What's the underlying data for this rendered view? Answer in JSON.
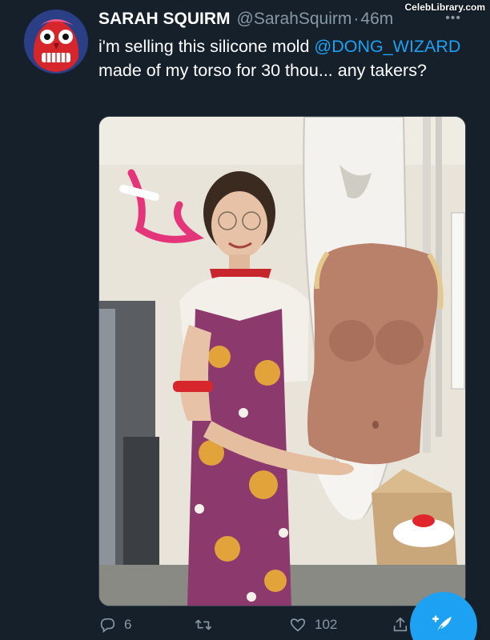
{
  "watermark": "CelebLibrary.com",
  "tweet": {
    "display_name": "SARAH SQUIRM",
    "handle": "@SarahSquirm",
    "separator": "·",
    "time": "46m",
    "text_before": "i'm selling this silicone mold ",
    "mention": "@DONG_WIZARD",
    "text_after": " made of my torso for 30 thou... any takers?"
  },
  "actions": {
    "reply_count": "6",
    "retweet_count": "",
    "like_count": "102"
  },
  "icons": {
    "more": "more-horizontal-icon",
    "reply": "reply-icon",
    "retweet": "retweet-icon",
    "like": "heart-icon",
    "share": "share-icon",
    "compose": "compose-tweet-icon"
  },
  "colors": {
    "background": "#15202b",
    "accent": "#1da1f2",
    "secondary_text": "#8899a6"
  }
}
